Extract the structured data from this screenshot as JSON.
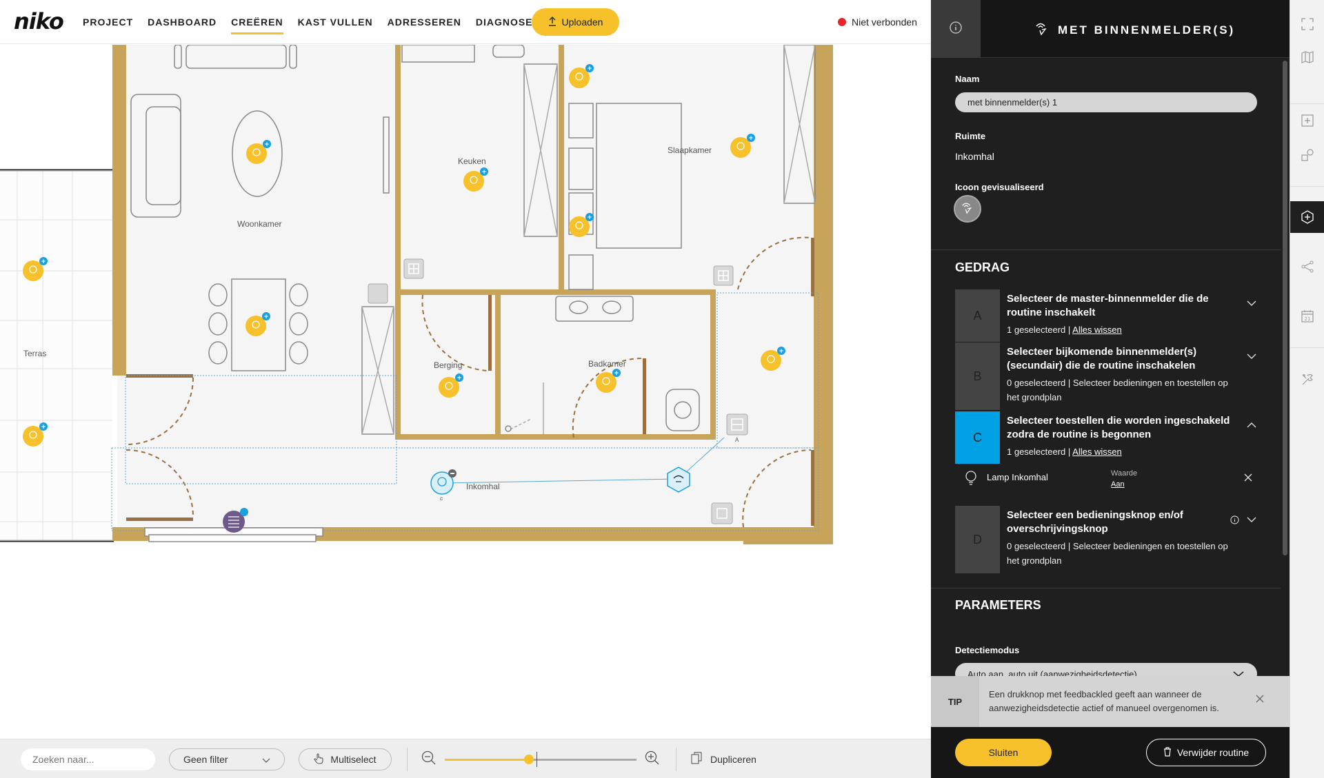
{
  "app": {
    "logo": "niko"
  },
  "nav": {
    "items": [
      {
        "label": "PROJECT",
        "active": false
      },
      {
        "label": "DASHBOARD",
        "active": false
      },
      {
        "label": "CREËREN",
        "active": true
      },
      {
        "label": "KAST VULLEN",
        "active": false
      },
      {
        "label": "ADRESSEREN",
        "active": false
      },
      {
        "label": "DIAGNOSE",
        "active": false
      }
    ],
    "upload_label": "Uploaden",
    "status_label": "Niet verbonden",
    "status_color": "#e4262b",
    "accent_color": "#f7c12b"
  },
  "floorplan": {
    "rooms": {
      "woonkamer": "Woonkamer",
      "keuken": "Keuken",
      "slaapkamer": "Slaapkamer",
      "terras": "Terras",
      "berging": "Berging",
      "badkamer": "Badkamer",
      "inkomhal": "Inkomhal"
    },
    "marker_letters": {
      "c": "c",
      "a": "A"
    }
  },
  "toolbar": {
    "search_placeholder": "Zoeken naar...",
    "filter_value": "Geen filter",
    "multiselect_label": "Multiselect",
    "duplicate_label": "Dupliceren",
    "zoom_level": 0.44
  },
  "panel": {
    "title": "MET BINNENMELDER(S)",
    "name_label": "Naam",
    "name_value": "met binnenmelder(s) 1",
    "room_label": "Ruimte",
    "room_value": "Inkomhal",
    "icon_label": "Icoon gevisualiseerd",
    "behaviour_title": "GEDRAG",
    "steps": [
      {
        "letter": "A",
        "title": "Selecteer de master-binnenmelder die de routine inschakelt",
        "selected": "1 geselecteerd",
        "sep": " | ",
        "action": "Alles wissen",
        "hint": "",
        "expanded": false
      },
      {
        "letter": "B",
        "title": "Selecteer bijkomende binnenmelder(s) (secundair) die de routine inschakelen",
        "selected": "0 geselecteerd",
        "sep": " | ",
        "action": "",
        "hint": "Selecteer bedieningen en toestellen op het grondplan",
        "expanded": false
      },
      {
        "letter": "C",
        "title": "Selecteer toestellen die worden ingeschakeld zodra de routine is begonnen",
        "selected": "1 geselecteerd",
        "sep": " | ",
        "action": "Alles wissen",
        "hint": "",
        "expanded": true
      },
      {
        "letter": "D",
        "title": "Selecteer een bedieningsknop en/of overschrijvingsknop",
        "selected": "0 geselecteerd",
        "sep": " | ",
        "action": "",
        "hint": "Selecteer bedieningen en toestellen op het grondplan",
        "expanded": false
      }
    ],
    "step_c_item": {
      "name": "Lamp Inkomhal",
      "value_label": "Waarde",
      "value": "Aan"
    },
    "parameters_title": "PARAMETERS",
    "detection_label": "Detectiemodus",
    "detection_value": "Auto aan, auto uit (aanwezigheidsdetectie)",
    "tip_label": "TIP",
    "tip_text": "Een drukknop met feedbackled geeft aan wanneer de aanwezigheidsdetectie actief of manueel overgenomen is.",
    "close_label": "Sluiten",
    "delete_label": "Verwijder routine",
    "step_c_color": "#00a0e4"
  },
  "rail": {
    "icons": [
      "fullscreen-icon",
      "map-icon",
      "add-box-icon",
      "shapes-icon",
      "routine-icon",
      "connections-icon",
      "calendar-icon",
      "tools-icon"
    ],
    "calendar_day": "21"
  }
}
